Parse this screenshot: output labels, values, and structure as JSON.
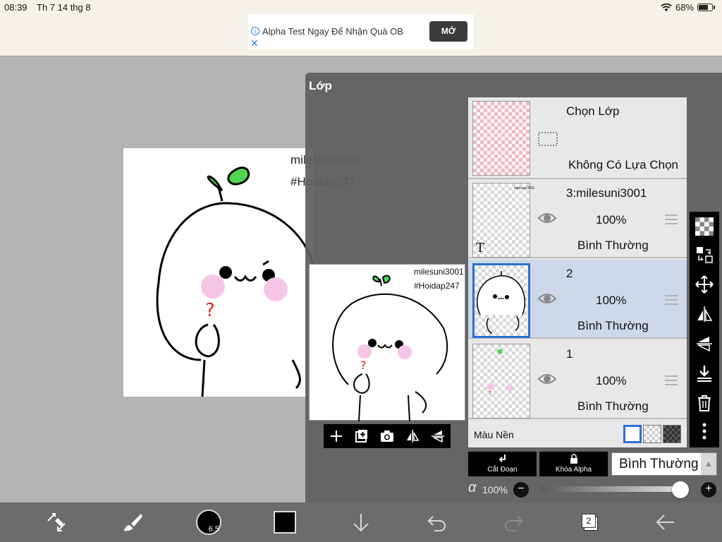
{
  "status_bar": {
    "time": "08:39",
    "date": "Th 7 14 thg 8",
    "battery": "68%"
  },
  "ad": {
    "text": "Alpha Test Ngay Để Nhận Quà OB",
    "button": "MỞ"
  },
  "canvas": {
    "text_line1": "milesuni3001",
    "text_line2": "#Hoidap247"
  },
  "panel": {
    "title": "Lớp",
    "preview_text1": "milesuni3001",
    "preview_text2": "#Hoidap247",
    "selection": {
      "title": "Chọn Lớp",
      "status": "Không Có Lựa Chọn"
    },
    "layers": [
      {
        "name": "3:milesuni3001",
        "opacity": "100%",
        "mode": "Bình Thường"
      },
      {
        "name": "2",
        "opacity": "100%",
        "mode": "Bình Thường"
      },
      {
        "name": "1",
        "opacity": "100%",
        "mode": "Bình Thường"
      }
    ],
    "background_label": "Màu Nền",
    "clip_label": "Cắt Đoạn",
    "alpha_lock_label": "Khóa Alpha",
    "blend_mode": "Bình Thường",
    "alpha_symbol": "α",
    "opacity_value": "100%",
    "opacity_fraction": 1.0
  },
  "toolbar": {
    "brush_size": "6.5",
    "layer_count": "2",
    "color": "#000000"
  }
}
